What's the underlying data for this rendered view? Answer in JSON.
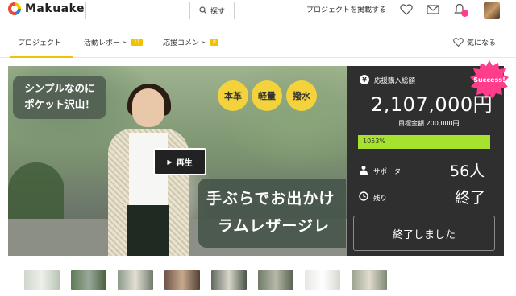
{
  "header": {
    "logo_text": "Makuake",
    "search_placeholder": "",
    "search_button": "探す",
    "post_project": "プロジェクトを掲載する",
    "icons": [
      "heart-icon",
      "mail-icon",
      "bell-icon",
      "avatar"
    ]
  },
  "tabs": {
    "items": [
      {
        "label": "プロジェクト",
        "count": ""
      },
      {
        "label": "活動レポート",
        "count": "11"
      },
      {
        "label": "応援コメント",
        "count": "8"
      }
    ],
    "favorite": "気になる"
  },
  "hero": {
    "badge_lines": [
      "シンプルなのに",
      "ポケット沢山！"
    ],
    "circles": [
      "本革",
      "軽量",
      "撥水"
    ],
    "play_label": "再生",
    "caption_lines": [
      "手ぶらでお出かけ",
      "ラムレザージレ"
    ]
  },
  "panel": {
    "success": "Success!",
    "total_label": "応援購入総額",
    "amount": "2,107,000円",
    "goal": "目標金額 200,000円",
    "progress_text": "1053%",
    "progress_percent": 1053,
    "supporters_label": "サポーター",
    "supporters_value": "56人",
    "remaining_label": "残り",
    "remaining_value": "終了",
    "end_button": "終了しました"
  },
  "colors": {
    "accent": "#f2c200",
    "panel_bg": "#2f2f2f",
    "progress": "#a7e22e",
    "success": "#ff3d8b"
  },
  "thumbnails": [
    "thumb-1",
    "thumb-2",
    "thumb-3",
    "thumb-4",
    "thumb-5",
    "thumb-6",
    "thumb-7",
    "thumb-8"
  ]
}
